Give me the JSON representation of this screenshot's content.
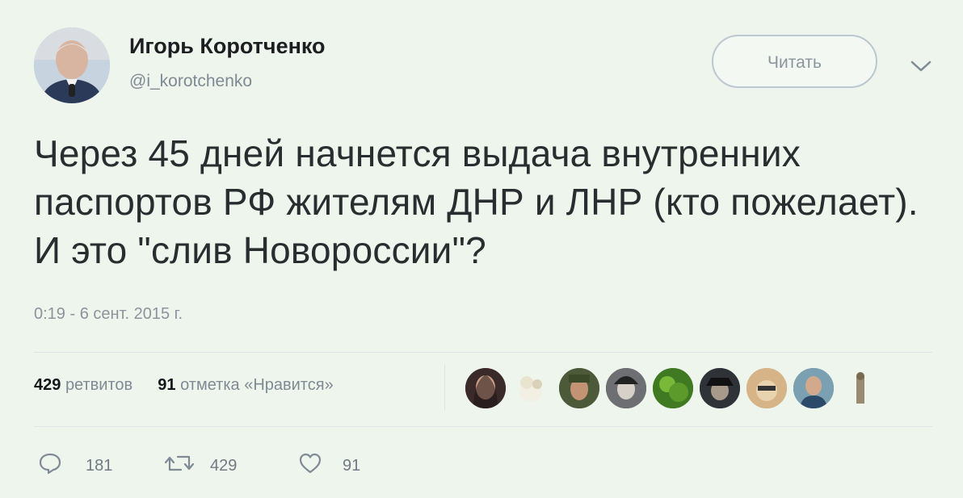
{
  "author": {
    "name": "Игорь Коротченко",
    "handle": "@i_korotchenko"
  },
  "follow_button": {
    "label": "Читать"
  },
  "tweet": {
    "text": "Через 45 дней начнется выдача внутренних паспортов РФ жителям ДНР и ЛНР (кто пожелает). И это \"слив Новороссии\"?",
    "timestamp": "0:19 - 6 сент. 2015 г."
  },
  "stats": {
    "retweets_count": "429",
    "retweets_label": "ретвитов",
    "likes_count": "91",
    "likes_label": "отметка «Нравится»"
  },
  "actions": {
    "reply_count": "181",
    "retweet_count": "429",
    "like_count": "91"
  },
  "likers": [
    {
      "icon": "liker-avatar",
      "color": "#5a3a3a"
    },
    {
      "icon": "liker-avatar",
      "color": "#e9ecd9"
    },
    {
      "icon": "liker-avatar",
      "color": "#4d5a3a"
    },
    {
      "icon": "liker-avatar",
      "color": "#3d3f42"
    },
    {
      "icon": "liker-avatar",
      "color": "#4f8a2a"
    },
    {
      "icon": "liker-avatar",
      "color": "#2f3337"
    },
    {
      "icon": "liker-avatar",
      "color": "#c99a6a"
    },
    {
      "icon": "liker-avatar",
      "color": "#3f6a7a"
    },
    {
      "icon": "liker-avatar",
      "color": "#9a8a72"
    }
  ],
  "colors": {
    "background": "#eef5ec",
    "text": "#14171a",
    "muted": "#7f8a94"
  }
}
